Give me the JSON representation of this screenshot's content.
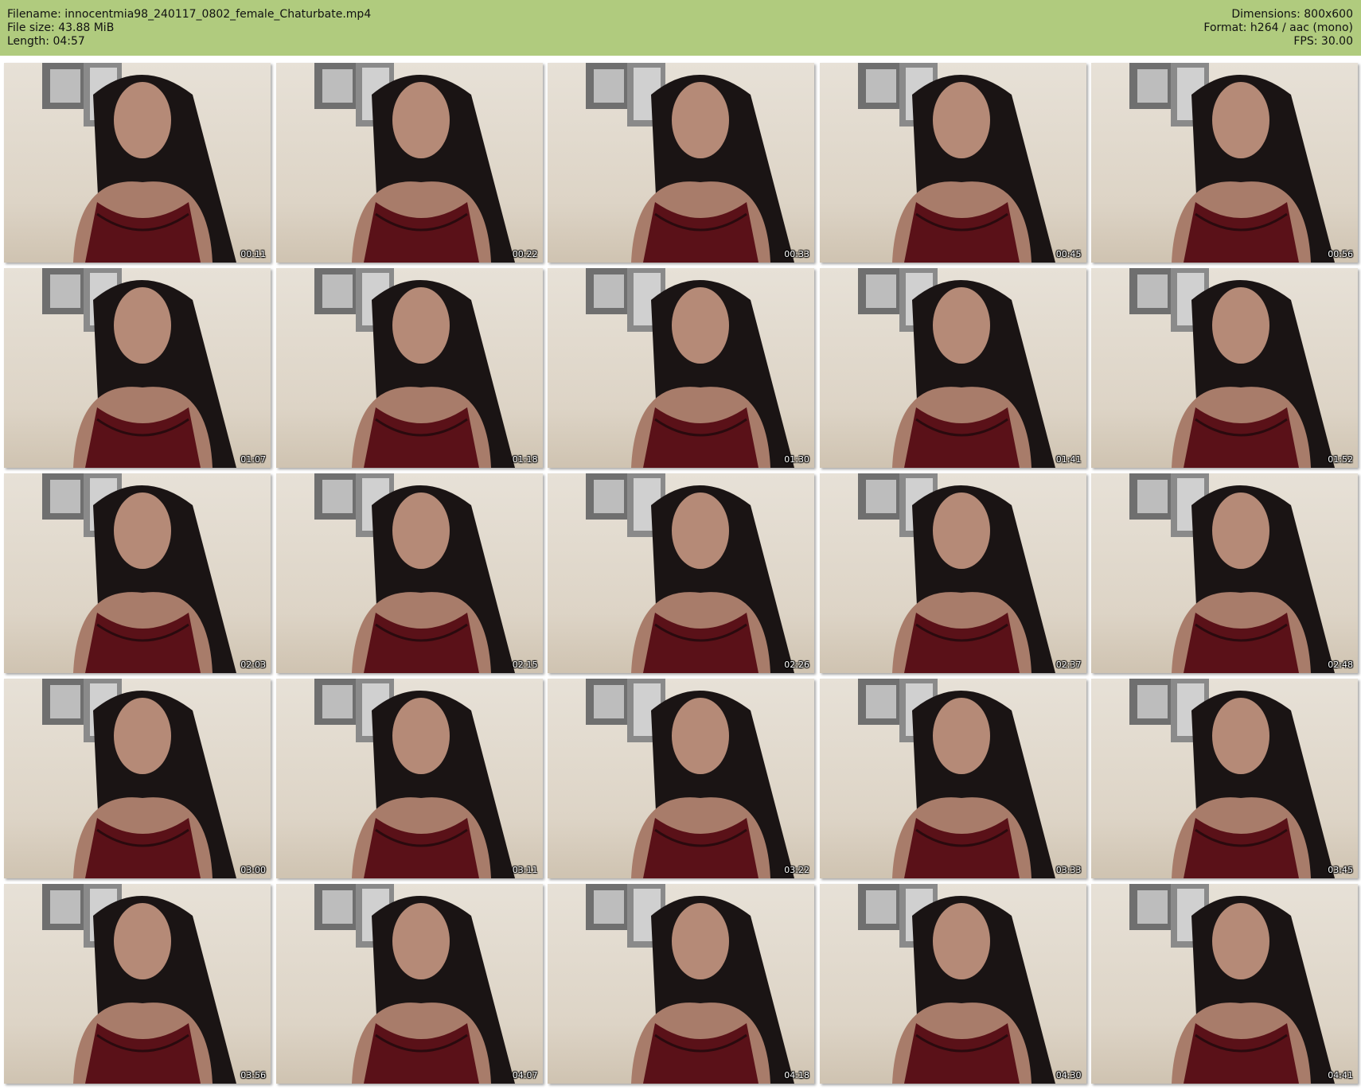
{
  "header": {
    "filename_line": "Filename: innocentmia98_240117_0802_female_Chaturbate.mp4",
    "filesize_line": "File size: 43.88 MiB",
    "length_line": "Length: 04:57",
    "dimensions_line": "Dimensions: 800x600",
    "format_line": "Format: h264 / aac (mono)",
    "fps_line": "FPS: 30.00"
  },
  "colors": {
    "header_bg": "#b0cb7e",
    "page_bg": "#ffffff"
  },
  "thumbnails": [
    {
      "timestamp": "00:11"
    },
    {
      "timestamp": "00:22"
    },
    {
      "timestamp": "00:33"
    },
    {
      "timestamp": "00:45"
    },
    {
      "timestamp": "00:56"
    },
    {
      "timestamp": "01:07"
    },
    {
      "timestamp": "01:18"
    },
    {
      "timestamp": "01:30"
    },
    {
      "timestamp": "01:41"
    },
    {
      "timestamp": "01:52"
    },
    {
      "timestamp": "02:03"
    },
    {
      "timestamp": "02:15"
    },
    {
      "timestamp": "02:26"
    },
    {
      "timestamp": "02:37"
    },
    {
      "timestamp": "02:48"
    },
    {
      "timestamp": "03:00"
    },
    {
      "timestamp": "03:11"
    },
    {
      "timestamp": "03:22"
    },
    {
      "timestamp": "03:33"
    },
    {
      "timestamp": "03:45"
    },
    {
      "timestamp": "03:56"
    },
    {
      "timestamp": "04:07"
    },
    {
      "timestamp": "04:18"
    },
    {
      "timestamp": "04:30"
    },
    {
      "timestamp": "04:41"
    }
  ]
}
